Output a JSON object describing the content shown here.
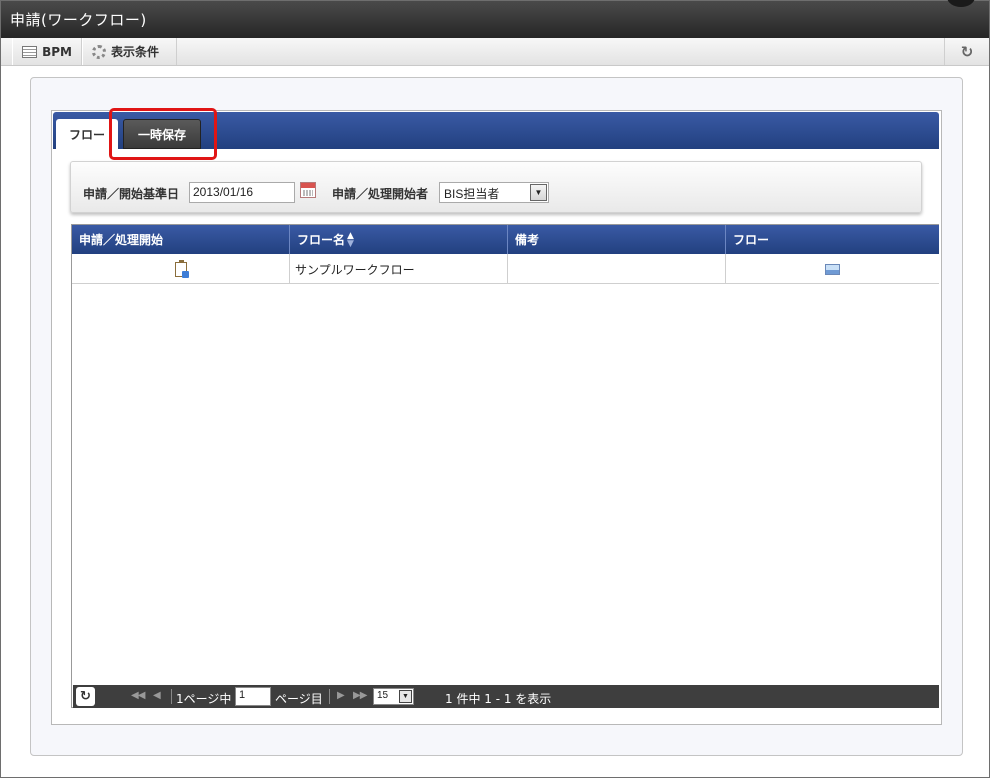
{
  "window": {
    "title": "申請(ワークフロー)"
  },
  "toolbar": {
    "bpm_label": "BPM",
    "conditions_label": "表示条件",
    "refresh_icon": "refresh-icon"
  },
  "tabs": [
    {
      "label": "フロー",
      "active": true
    },
    {
      "label": "一時保存",
      "active": false
    }
  ],
  "search": {
    "date_label": "申請／開始基準日",
    "date_value": "2013/01/16",
    "user_label": "申請／処理開始者",
    "user_selected": "BIS担当者"
  },
  "grid": {
    "columns": [
      "申請／処理開始",
      "フロー名",
      "備考",
      "フロー"
    ],
    "sorted_column": "フロー名",
    "rows": [
      {
        "start_icon": "clipboard-icon",
        "flow_name": "サンプルワークフロー",
        "remarks": "",
        "flow_icon": "image-icon"
      }
    ]
  },
  "pager": {
    "page_prefix": "1ページ中",
    "page_value": "1",
    "page_suffix": "ページ目",
    "page_size": "15",
    "summary": "1 件中 1 - 1 を表示"
  },
  "colors": {
    "header_blue": "#2d4c93",
    "highlight_red": "#e01515",
    "pager_dark": "#3e3e3e"
  }
}
